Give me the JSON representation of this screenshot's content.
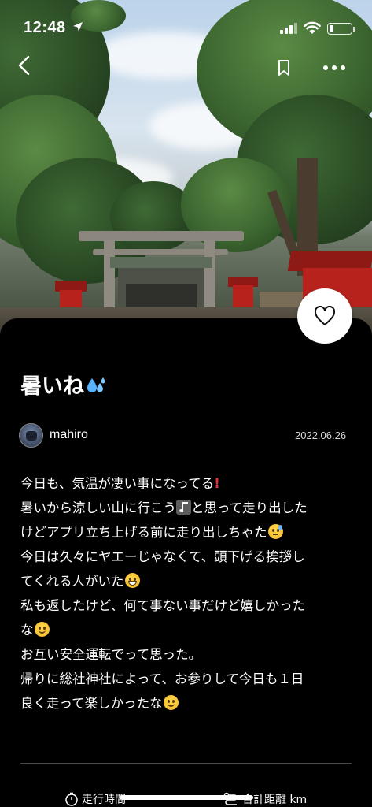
{
  "status_bar": {
    "time": "12:48",
    "battery_level": 0.2
  },
  "nav": {
    "back_icon": "chevron-left-icon",
    "bookmark_icon": "bookmark-icon",
    "more_icon": "more-horizontal-icon"
  },
  "post": {
    "title": "暑いね",
    "title_emoji": "sweat-droplets-icon",
    "author": "mahiro",
    "date": "2022.06.26",
    "body_lines": [
      "今日も、気温が凄い事になってる",
      "暑いから涼しい山に行こう",
      "と思って走り出した",
      "けどアプリ立ち上げる前に走り出しちゃた",
      "今日は久々にヤエーじゃなくて、頭下げる挨拶し",
      "てくれる人がいた",
      "私も返したけど、何て事ない事だけど嬉しかった",
      "な",
      "お互い安全運転でって思った。",
      "帰りに総社神社によって、お参りして今日も１日",
      "良く走って楽しかったな"
    ]
  },
  "stats": {
    "run_time_label": "走行時間",
    "distance_label": "合計距離 km"
  },
  "colors": {
    "background": "#000000",
    "text": "#ffffff",
    "date_text": "#d9d9d9",
    "divider": "#4a4a4a",
    "like_button_bg": "#ffffff"
  }
}
